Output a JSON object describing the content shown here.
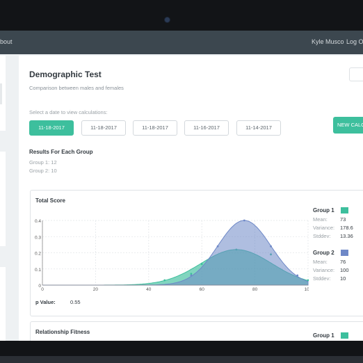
{
  "nav": {
    "about": "bout",
    "user": "Kyle Musco",
    "logout": "Log Out"
  },
  "page": {
    "title": "Demographic Test",
    "subtitle": "Comparison between males and females",
    "date_prompt": "Select a date to view calculations:",
    "new_calc": "NEW CALCULATION",
    "dates": [
      "11-18-2017",
      "11-18-2017",
      "11-18-2017",
      "11-16-2017",
      "11-14-2017"
    ],
    "selected_date_index": 0
  },
  "results": {
    "title": "Results For Each Group",
    "group1": "Group 1: 12",
    "group2": "Group 2: 10"
  },
  "total_score": {
    "title": "Total Score",
    "p_value_label": "p Value:",
    "p_value": "0.55",
    "groups": [
      {
        "name": "Group 1",
        "color": "#3dbf9d",
        "mean_label": "Mean:",
        "mean": "73",
        "variance_label": "Variance:",
        "variance": "178.6",
        "stddev_label": "Stddev:",
        "stddev": "13.36"
      },
      {
        "name": "Group 2",
        "color": "#6e88c7",
        "mean_label": "Mean:",
        "mean": "76",
        "variance_label": "Variance:",
        "variance": "100",
        "stddev_label": "Stddev:",
        "stddev": "10"
      }
    ]
  },
  "relationship": {
    "title": "Relationship Fitness",
    "group_name": "Group 1"
  },
  "chart_data": {
    "type": "area",
    "title": "Total Score",
    "xlim": [
      0,
      100
    ],
    "ylim": [
      0,
      0.4
    ],
    "x_ticks": [
      "0",
      "20",
      "40",
      "60",
      "80",
      "100"
    ],
    "y_ticks": [
      "0",
      "0.1",
      "0.2",
      "0.3",
      "0.4"
    ],
    "grid": true,
    "series": [
      {
        "name": "Group 1",
        "color": "#3dbf9d",
        "mean": 73,
        "stddev": 13.36,
        "peak": 0.22,
        "points": [
          [
            46,
            0.03
          ],
          [
            56,
            0.07
          ],
          [
            60,
            0.13
          ],
          [
            73,
            0.22
          ],
          [
            86,
            0.19
          ],
          [
            100,
            0.03
          ]
        ]
      },
      {
        "name": "Group 2",
        "color": "#6e88c7",
        "mean": 76,
        "stddev": 10,
        "peak": 0.4,
        "points": [
          [
            56,
            0.06
          ],
          [
            66,
            0.24
          ],
          [
            76,
            0.4
          ],
          [
            86,
            0.24
          ],
          [
            96,
            0.06
          ]
        ]
      }
    ]
  }
}
